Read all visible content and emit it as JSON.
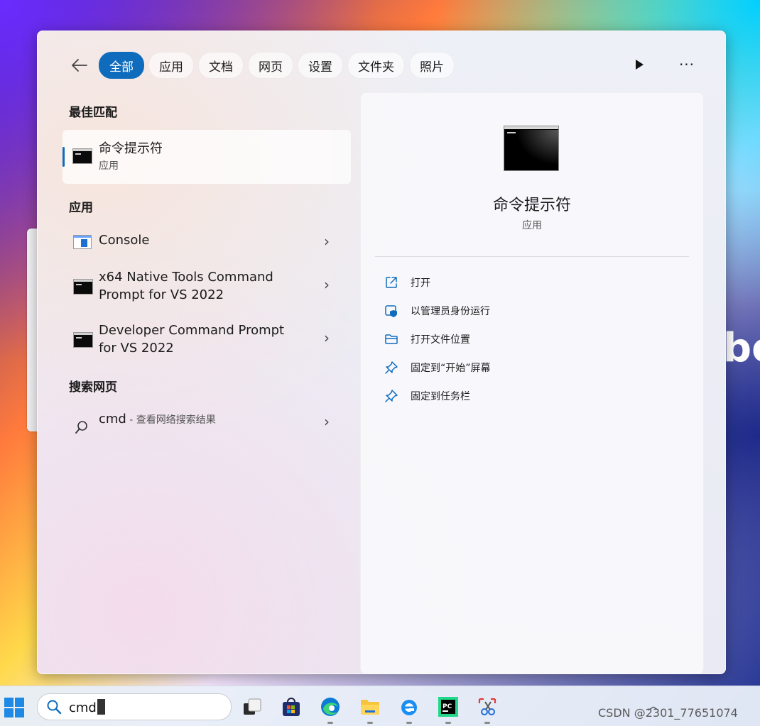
{
  "wallpaper": {
    "text": "bo"
  },
  "filters": {
    "back_label": "back",
    "chips": [
      "全部",
      "应用",
      "文档",
      "网页",
      "设置",
      "文件夹",
      "照片"
    ],
    "more_label": "···"
  },
  "best_match": {
    "section_title": "最佳匹配",
    "name": "命令提示符",
    "type": "应用"
  },
  "apps": {
    "section_title": "应用",
    "items": [
      {
        "line1": "Console",
        "line2": ""
      },
      {
        "line1": "x64 Native Tools Command",
        "line2": "Prompt for VS 2022"
      },
      {
        "line1": "Developer Command Prompt",
        "line2": "for VS 2022"
      }
    ]
  },
  "web": {
    "section_title": "搜索网页",
    "query": "cmd",
    "suffix": " - 查看网络搜索结果"
  },
  "detail": {
    "title": "命令提示符",
    "subtitle": "应用",
    "actions": [
      {
        "label": "打开",
        "icon": "open-icon"
      },
      {
        "label": "以管理员身份运行",
        "icon": "shield-icon"
      },
      {
        "label": "打开文件位置",
        "icon": "folder-icon"
      },
      {
        "label": "固定到“开始”屏幕",
        "icon": "pin-icon"
      },
      {
        "label": "固定到任务栏",
        "icon": "pin-icon"
      }
    ]
  },
  "taskbar": {
    "search_value": "cmd",
    "apps": [
      "task-view-icon",
      "store-icon",
      "edge-icon",
      "file-explorer-icon",
      "ie-icon",
      "pycharm-icon",
      "snipping-tool-icon"
    ],
    "watermark": "CSDN @2301_77651074"
  },
  "colors": {
    "accent": "#0f6cbd"
  }
}
